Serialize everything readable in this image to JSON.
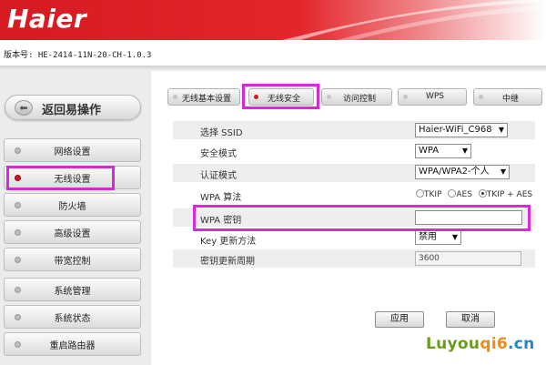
{
  "header": {
    "logo_text": "Haier",
    "version": "版本号: HE-2414-11N-20-CH-1.0.3"
  },
  "sidebar": {
    "back_label": "返回易操作",
    "back_icon": "arrow-left-icon",
    "items": [
      {
        "label": "网络设置"
      },
      {
        "label": "无线设置",
        "active": true
      },
      {
        "label": "防火墙"
      },
      {
        "label": "高级设置"
      },
      {
        "label": "带宽控制"
      },
      {
        "label": "系统管理"
      },
      {
        "label": "系统状态"
      },
      {
        "label": "重启路由器"
      }
    ]
  },
  "tabs": [
    {
      "label": "无线基本设置"
    },
    {
      "label": "无线安全",
      "active": true
    },
    {
      "label": "访问控制"
    },
    {
      "label": "WPS"
    },
    {
      "label": "中继"
    }
  ],
  "form": {
    "ssid": {
      "label": "选择 SSID",
      "value": "Haier-WiFi_C968"
    },
    "security_mode": {
      "label": "安全模式",
      "value": "WPA"
    },
    "auth_mode": {
      "label": "认证模式",
      "value": "WPA/WPA2-个人"
    },
    "wpa_algorithm": {
      "label": "WPA 算法",
      "options": [
        "TKIP",
        "AES",
        "TKIP + AES"
      ],
      "selected": "TKIP + AES"
    },
    "wpa_key": {
      "label": "WPA 密钥",
      "value": ""
    },
    "key_update_method": {
      "label": "Key 更新方法",
      "value": "禁用"
    },
    "key_update_period": {
      "label": "密钥更新周期",
      "value": "3600"
    }
  },
  "buttons": {
    "apply": "应用",
    "cancel": "取消"
  },
  "watermark": {
    "part1": "Luyou",
    "part2": "qi6",
    "part3": ".cn"
  },
  "colors": {
    "brand_red": "#d71a21",
    "highlight_magenta": "#d62bd4",
    "active_dot": "#d0191f"
  }
}
